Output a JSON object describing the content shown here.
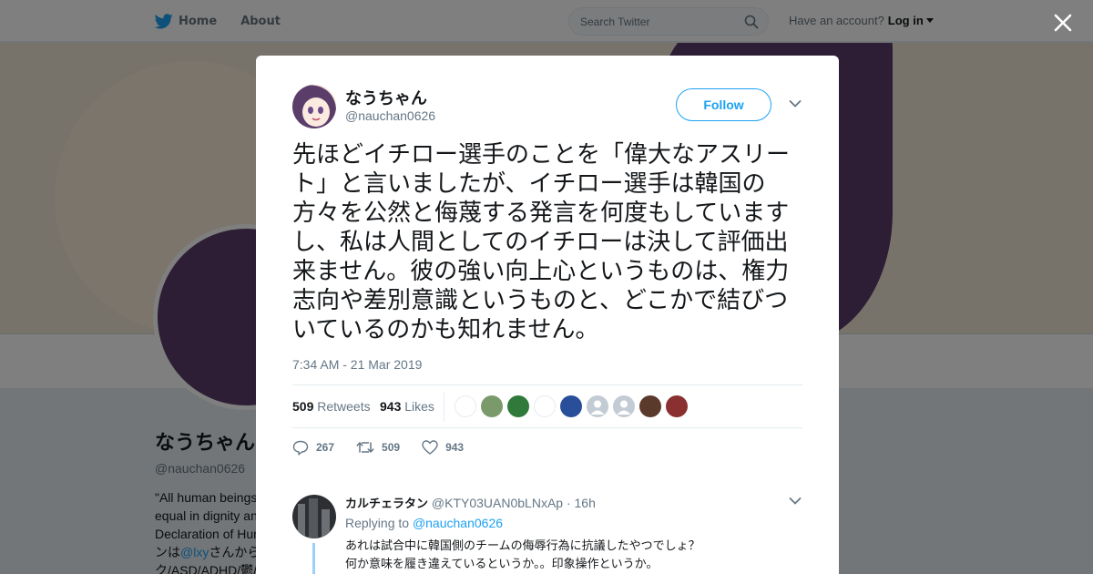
{
  "nav": {
    "home_label": "Home",
    "about_label": "About",
    "search_placeholder": "Search Twitter",
    "have_account": "Have an account?",
    "login_label": "Log in"
  },
  "profile_bg": {
    "name": "なうちゃん",
    "handle": "@nauchan0626",
    "bio_lines": [
      "\"All human beings",
      "equal in dignity an",
      "Declaration of Hur",
      "ンは",
      "@lxy",
      "さんから",
      "ク/ASD/ADHD/鬱/"
    ]
  },
  "tweet": {
    "display_name": "なうちゃん",
    "handle": "@nauchan0626",
    "follow_label": "Follow",
    "text": "先ほどイチロー選手のことを「偉大なアスリート」と言いましたが、イチロー選手は韓国の方々を公然と侮蔑する発言を何度もしていますし、私は人間としてのイチローは決して評価出来ません。彼の強い向上心というものは、権力志向や差別意識というものと、どこかで結びついているのかも知れません。",
    "timestamp": "7:34 AM - 21 Mar 2019",
    "retweets_count": "509",
    "retweets_label": "Retweets",
    "likes_count": "943",
    "likes_label": "Likes",
    "liker_avatars": [
      {
        "icon": "text-avatar-icon",
        "color": "#ffffff"
      },
      {
        "icon": "avatar-icon",
        "color": "#7a9a6b"
      },
      {
        "icon": "avatar-icon",
        "color": "#2f7a3a"
      },
      {
        "icon": "avatar-icon",
        "color": "#ffffff"
      },
      {
        "icon": "avatar-icon",
        "color": "#2a4f9a"
      },
      {
        "icon": "default-avatar-icon",
        "color": "#c3ccd4"
      },
      {
        "icon": "default-avatar-icon",
        "color": "#c3ccd4"
      },
      {
        "icon": "avatar-icon",
        "color": "#5a3a2a"
      },
      {
        "icon": "avatar-icon",
        "color": "#8a3030"
      }
    ],
    "reply_count": "267",
    "retweet_action_count": "509",
    "like_action_count": "943"
  },
  "reply": {
    "name": "カルチェラタン",
    "handle": "@KTY03UAN0bLNxAp",
    "time": "· 16h",
    "replying_to_label": "Replying to",
    "replying_to_handle": "@nauchan0626",
    "line1": "あれは試合中に韓国側のチームの侮辱行為に抗議したやつでしょ？",
    "line2": "何か意味を履き違えているというか。。印象操作というか。"
  },
  "colors": {
    "brand": "#1da1f2",
    "text": "#14171a",
    "muted": "#657786"
  }
}
